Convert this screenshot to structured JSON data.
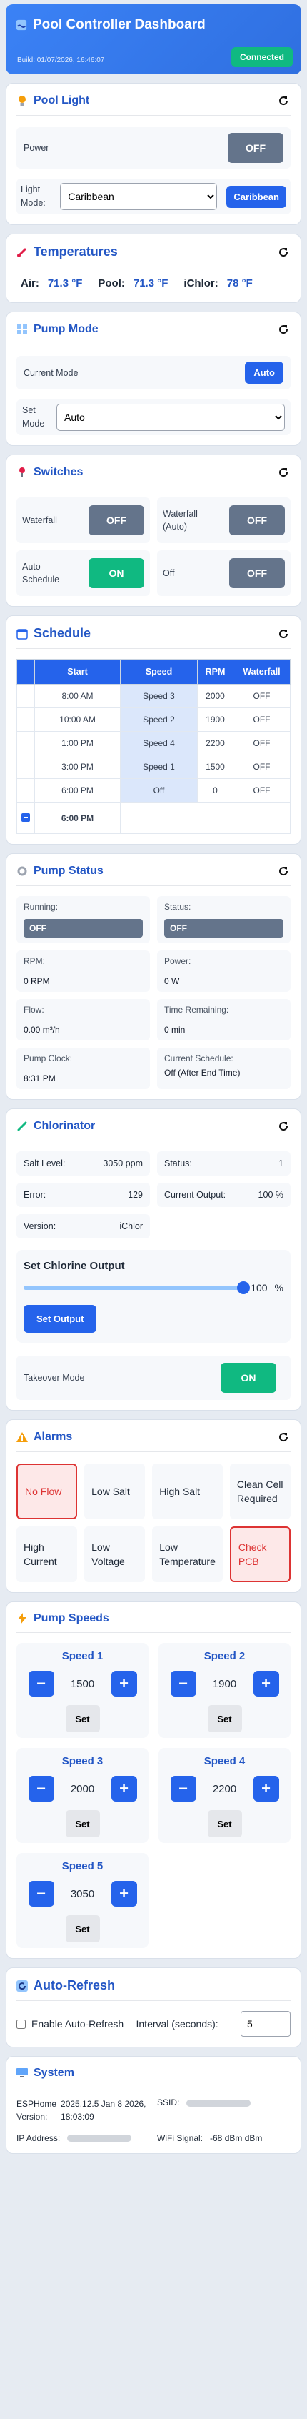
{
  "header": {
    "title": "Pool Controller Dashboard",
    "build": "Build: 01/07/2026, 16:46:07",
    "status": "Connected"
  },
  "pool_light": {
    "title": "Pool Light",
    "power_label": "Power",
    "power_state": "OFF",
    "mode_label": "Light Mode:",
    "mode_value": "Caribbean",
    "mode_button": "Caribbean"
  },
  "temperatures": {
    "title": "Temperatures",
    "air_label": "Air:",
    "air": "71.3 °F",
    "pool_label": "Pool:",
    "pool": "71.3 °F",
    "ichlor_label": "iChlor:",
    "ichlor": "78 °F"
  },
  "pump_mode": {
    "title": "Pump Mode",
    "current_label": "Current Mode",
    "current_value": "Auto",
    "set_label": "Set Mode",
    "set_value": "Auto"
  },
  "switches": {
    "title": "Switches",
    "items": [
      {
        "label": "Waterfall",
        "state": "OFF"
      },
      {
        "label": "Waterfall (Auto)",
        "state": "OFF"
      },
      {
        "label": "Auto Schedule",
        "state": "ON"
      },
      {
        "label": "Off",
        "state": "OFF"
      }
    ]
  },
  "schedule": {
    "title": "Schedule",
    "headers": [
      "",
      "Start",
      "Speed",
      "RPM",
      "Waterfall"
    ],
    "rows": [
      {
        "start": "8:00 AM",
        "speed": "Speed 3",
        "rpm": "2000",
        "waterfall": "OFF"
      },
      {
        "start": "10:00 AM",
        "speed": "Speed 2",
        "rpm": "1900",
        "waterfall": "OFF"
      },
      {
        "start": "1:00 PM",
        "speed": "Speed 4",
        "rpm": "2200",
        "waterfall": "OFF"
      },
      {
        "start": "3:00 PM",
        "speed": "Speed 1",
        "rpm": "1500",
        "waterfall": "OFF"
      },
      {
        "start": "6:00 PM",
        "speed": "Off",
        "rpm": "0",
        "waterfall": "OFF"
      }
    ],
    "end_time": "6:00 PM"
  },
  "pump_status": {
    "title": "Pump Status",
    "running_label": "Running:",
    "running": "OFF",
    "status_label": "Status:",
    "status": "OFF",
    "rpm_label": "RPM:",
    "rpm": "0 RPM",
    "power_label": "Power:",
    "power": "0 W",
    "flow_label": "Flow:",
    "flow": "0.00 m³/h",
    "time_label": "Time Remaining:",
    "time": "0 min",
    "clock_label": "Pump Clock:",
    "clock": "8:31 PM",
    "sched_label": "Current Schedule:",
    "sched": "Off (After End Time)"
  },
  "chlorinator": {
    "title": "Chlorinator",
    "salt_label": "Salt Level:",
    "salt": "3050 ppm",
    "status_label": "Status:",
    "status": "1",
    "error_label": "Error:",
    "error": "129",
    "output_label": "Current Output:",
    "output": "100 %",
    "version_label": "Version:",
    "version": "iChlor",
    "set_title": "Set Chlorine Output",
    "set_value": "100",
    "unit": "%",
    "set_button": "Set Output",
    "slider_fraction": 1.0,
    "takeover_label": "Takeover Mode",
    "takeover_state": "ON"
  },
  "alarms": {
    "title": "Alarms",
    "items": [
      {
        "label": "No Flow",
        "active": true
      },
      {
        "label": "Low Salt",
        "active": false
      },
      {
        "label": "High Salt",
        "active": false
      },
      {
        "label": "Clean Cell Required",
        "active": false
      },
      {
        "label": "High Current",
        "active": false
      },
      {
        "label": "Low Voltage",
        "active": false
      },
      {
        "label": "Low Temperature",
        "active": false
      },
      {
        "label": "Check PCB",
        "active": true
      }
    ]
  },
  "pump_speeds": {
    "title": "Pump Speeds",
    "set_label": "Set",
    "items": [
      {
        "name": "Speed 1",
        "value": "1500"
      },
      {
        "name": "Speed 2",
        "value": "1900"
      },
      {
        "name": "Speed 3",
        "value": "2000"
      },
      {
        "name": "Speed 4",
        "value": "2200"
      },
      {
        "name": "Speed 5",
        "value": "3050"
      }
    ]
  },
  "auto_refresh": {
    "title": "Auto-Refresh",
    "enable_label": "Enable Auto-Refresh",
    "interval_label": "Interval (seconds):",
    "interval": "5"
  },
  "system": {
    "title": "System",
    "esphome_label": "ESPHome Version:",
    "esphome": "2025.12.5 Jan 8 2026, 18:03:09",
    "ssid_label": "SSID:",
    "ip_label": "IP Address:",
    "wifi_label": "WiFi Signal:",
    "wifi": "-68 dBm dBm"
  },
  "colors": {
    "accent": "#2563eb",
    "on": "#10b981",
    "off": "#64748b",
    "alarm": "#dd3333"
  }
}
